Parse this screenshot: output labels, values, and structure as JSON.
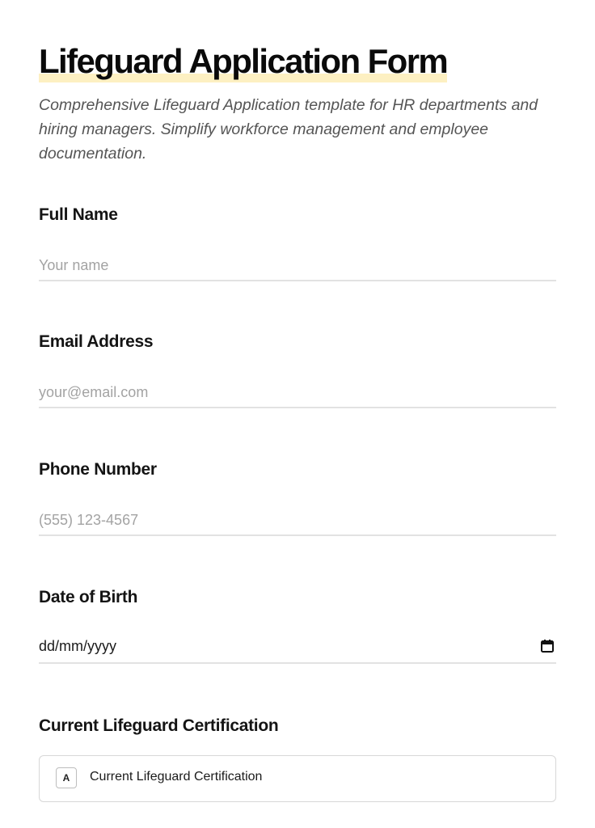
{
  "form": {
    "title": "Lifeguard Application Form",
    "subtitle": "Comprehensive Lifeguard Application template for HR departments and hiring managers. Simplify workforce management and employee documentation."
  },
  "fields": {
    "full_name": {
      "label": "Full Name",
      "placeholder": "Your name",
      "value": ""
    },
    "email": {
      "label": "Email Address",
      "placeholder": "your@email.com",
      "value": ""
    },
    "phone": {
      "label": "Phone Number",
      "placeholder": "(555) 123-4567",
      "value": ""
    },
    "dob": {
      "label": "Date of Birth",
      "value": "dd/mm/yyyy",
      "icon": "calendar-icon"
    },
    "certification": {
      "label": "Current Lifeguard Certification",
      "options": [
        {
          "key": "A",
          "label": "Current Lifeguard Certification"
        }
      ]
    }
  },
  "colors": {
    "title_highlight": "#fdf0c2",
    "input_border": "#e2e2e2",
    "placeholder": "#a3a3a3"
  }
}
